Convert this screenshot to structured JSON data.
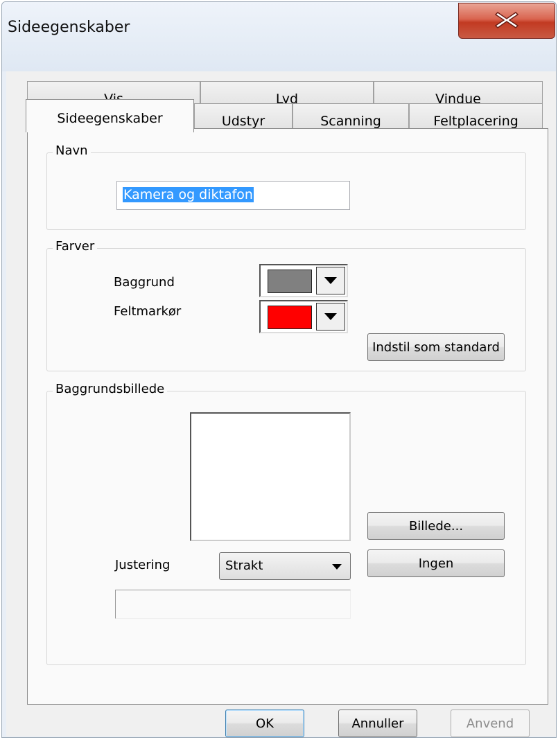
{
  "window": {
    "title": "Sideegenskaber"
  },
  "tabs": {
    "row_back": [
      "Vis",
      "Lyd",
      "Vindue"
    ],
    "row_front": [
      "Sideegenskaber",
      "Udstyr",
      "Scanning",
      "Feltplacering"
    ],
    "active": "Sideegenskaber"
  },
  "name_group": {
    "legend": "Navn",
    "value": "Kamera og diktafon"
  },
  "colors_group": {
    "legend": "Farver",
    "background_label": "Baggrund",
    "background_color": "#808080",
    "marker_label": "Feltmarkør",
    "marker_color": "#ff0000",
    "set_default_button": "Indstil som standard"
  },
  "image_group": {
    "legend": "Baggrundsbillede",
    "alignment_label": "Justering",
    "alignment_value": "Strakt",
    "image_button": "Billede...",
    "none_button": "Ingen"
  },
  "footer": {
    "ok": "OK",
    "cancel": "Annuller",
    "apply": "Anvend"
  },
  "icons": {
    "close": "close-icon",
    "dropdown": "chevron-down-icon"
  }
}
